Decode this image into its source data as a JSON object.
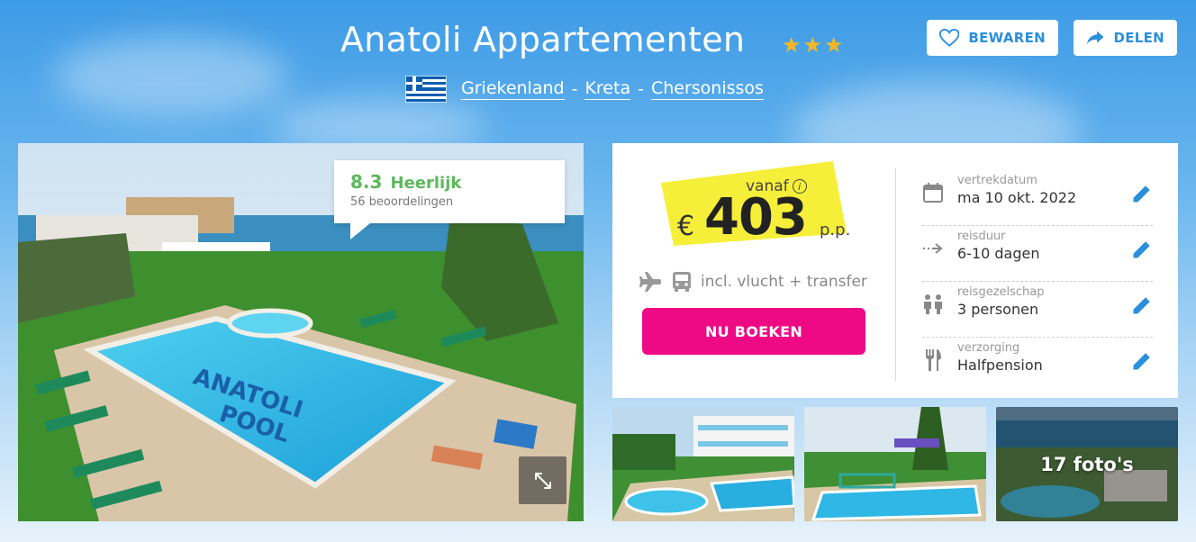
{
  "header": {
    "title": "Anatoli Appartementen",
    "stars": "★★★",
    "breadcrumb": [
      "Griekenland",
      "Kreta",
      "Chersonissos"
    ],
    "separator": "-",
    "save_label": "BEWAREN",
    "share_label": "DELEN"
  },
  "rating": {
    "score": "8.3",
    "label": "Heerlijk",
    "count": "56 beoordelingen"
  },
  "booking": {
    "from_label": "vanaf",
    "currency": "€",
    "price": "403",
    "per_person": "p.p.",
    "includes": "incl. vlucht + transfer",
    "book_label": "NU BOEKEN"
  },
  "details": [
    {
      "label": "vertrekdatum",
      "value": "ma 10 okt. 2022",
      "icon": "calendar-icon"
    },
    {
      "label": "reisduur",
      "value": "6-10 dagen",
      "icon": "arrow-right-icon"
    },
    {
      "label": "reisgezelschap",
      "value": "3 personen",
      "icon": "people-icon"
    },
    {
      "label": "verzorging",
      "value": "Halfpension",
      "icon": "utensils-icon"
    }
  ],
  "gallery": {
    "photo_count_label": "17 foto's"
  },
  "colors": {
    "accent": "#2b8fdc",
    "book_button": "#ef0a85",
    "rating": "#5cb85c",
    "star": "#f5b824",
    "highlight": "#f6ef3a"
  }
}
